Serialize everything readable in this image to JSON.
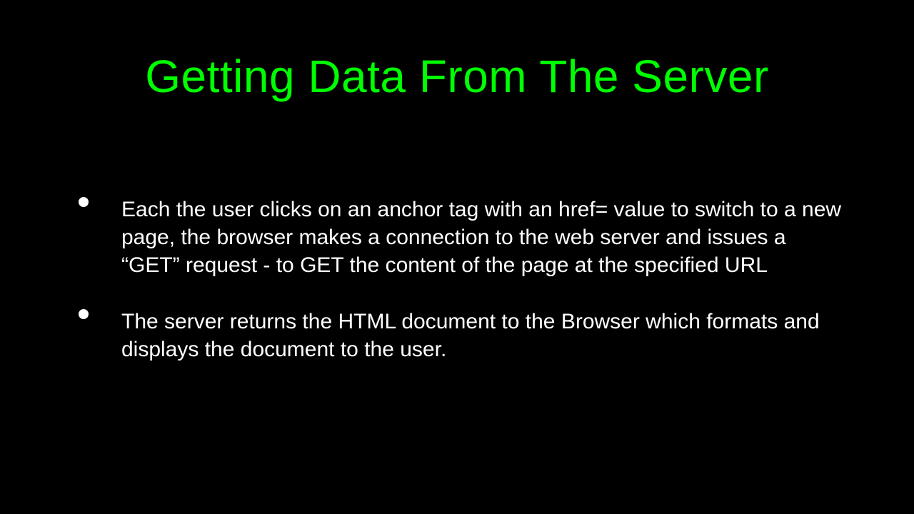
{
  "slide": {
    "title": "Getting Data From The Server",
    "bullets": [
      "Each the user clicks on an anchor tag with an href= value to switch to a new page, the browser makes a connection to the web server and issues a “GET” request - to GET the content of the page at the specified URL",
      "The server returns the HTML document to the Browser which formats and displays the document to the user."
    ]
  }
}
